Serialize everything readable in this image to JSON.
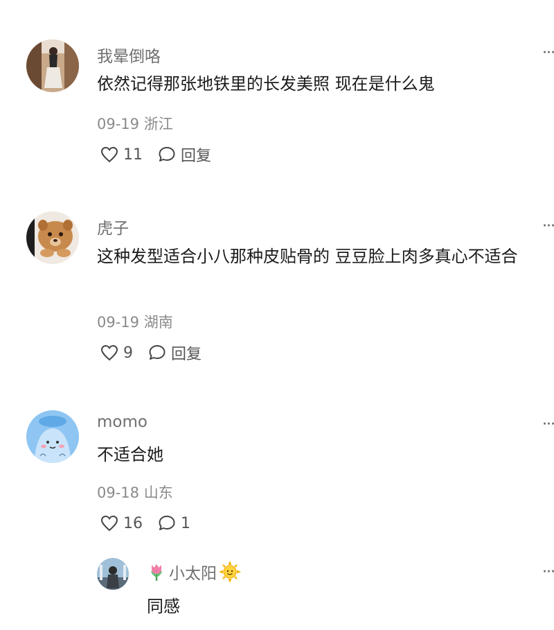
{
  "comments": [
    {
      "username": "我晕倒咯",
      "content": "依然记得那张地铁里的长发美照 现在是什么鬼",
      "date": "09-19",
      "location": "浙江",
      "likes": "11",
      "reply_label": "回复",
      "avatar": "woman-photo"
    },
    {
      "username": "虎子",
      "content": "这种发型适合小八那种皮贴骨的 豆豆脸上肉多真心不适合",
      "date": "09-19",
      "location": "湖南",
      "likes": "9",
      "reply_label": "回复",
      "avatar": "lion-cub-photo"
    },
    {
      "username": "momo",
      "content": "不适合她",
      "date": "09-18",
      "location": "山东",
      "likes": "16",
      "reply_count": "1",
      "avatar": "blue-cartoon"
    }
  ],
  "reply": {
    "username": "小太阳",
    "prefix_icon": "tulip-icon",
    "suffix_icon": "sun-icon",
    "content": "同感",
    "avatar": "girl-photo"
  },
  "more_label": "···",
  "colors": {
    "username": "#6f6f6f",
    "meta": "#8a8a8a",
    "avatar_blue": "#8ec5f2"
  }
}
